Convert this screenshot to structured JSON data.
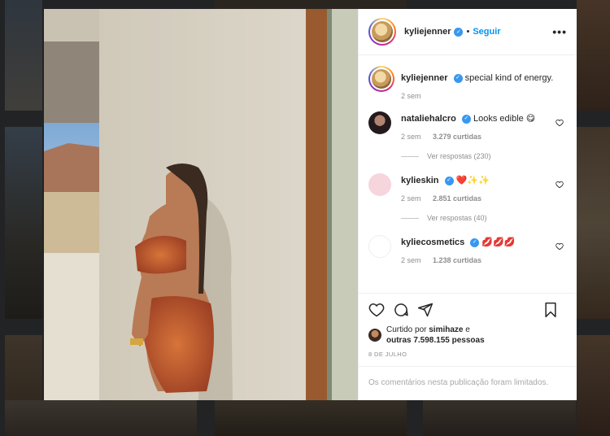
{
  "post": {
    "username": "kyliejenner",
    "dot": "•",
    "follow_label": "Seguir",
    "more_label": "•••",
    "caption_user": "kyliejenner",
    "caption_text": "special kind of energy.",
    "caption_time": "2 sem"
  },
  "comments": [
    {
      "user": "nataliehalcro",
      "text": "Looks edible 😋",
      "time": "2 sem",
      "likes": "3.279 curtidas",
      "replies": "Ver respostas (230)",
      "avatar_color": "#2b2024"
    },
    {
      "user": "kylieskin",
      "text": "❤️✨✨",
      "time": "2 sem",
      "likes": "2.851 curtidas",
      "replies": "Ver respostas (40)",
      "avatar_color": "#f6d5dc"
    },
    {
      "user": "kyliecosmetics",
      "text": "💋💋💋",
      "time": "2 sem",
      "likes": "1.238 curtidas",
      "avatar_color": "#ffffff"
    }
  ],
  "likes": {
    "prefix": "Curtido por",
    "user": "simihaze",
    "suffix": "e",
    "others": "outras 7.598.155 pessoas"
  },
  "date": "8 DE JULHO",
  "limited_text": "Os comentários nesta publicação foram limitados.",
  "colors": {
    "accent": "#0095f6",
    "verified": "#3897f0",
    "text": "#262626",
    "muted": "#8e8e8e"
  },
  "icons": [
    "verified-icon",
    "more-icon",
    "heart-icon",
    "comment-icon",
    "share-icon",
    "bookmark-icon"
  ]
}
